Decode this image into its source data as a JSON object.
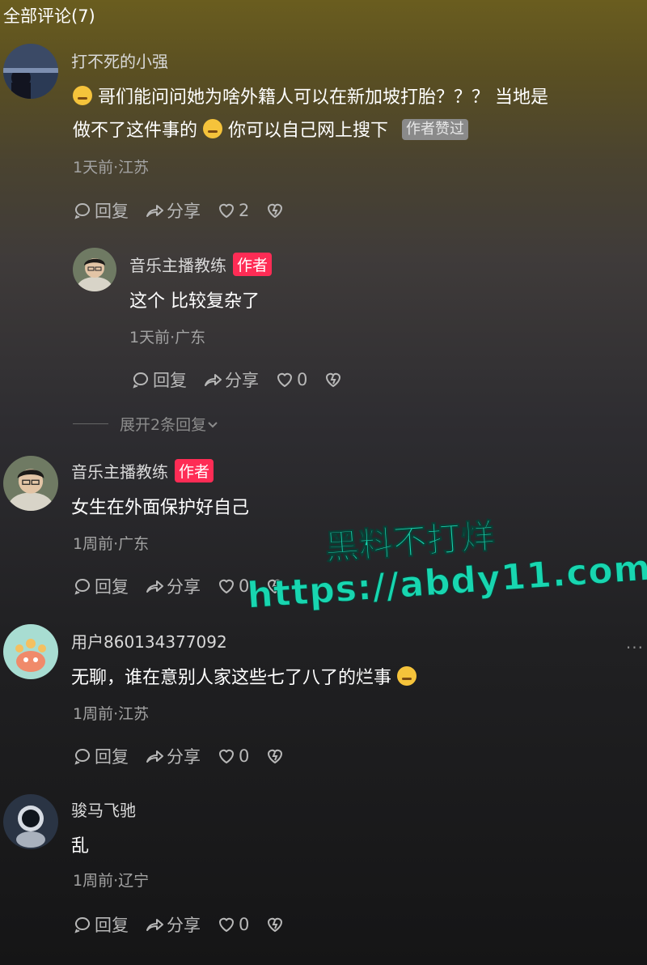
{
  "header": {
    "title": "全部评论(7)"
  },
  "comments": [
    {
      "name": "打不死的小强",
      "text_a": "哥们能问问她为啥外籍人可以在新加坡打胎？？？ 当地是",
      "text_b": "做不了这件事的",
      "text_c": "你可以自己网上搜下",
      "liked_badge": "作者赞过",
      "meta": "1天前·江苏",
      "reply_label": "回复",
      "share_label": "分享",
      "likes": "2"
    },
    {
      "name": "音乐主播教练",
      "badge": "作者",
      "text": "这个 比较复杂了",
      "meta": "1天前·广东",
      "reply_label": "回复",
      "share_label": "分享",
      "likes": "0"
    },
    {
      "name": "音乐主播教练",
      "badge": "作者",
      "text": "女生在外面保护好自己",
      "meta": "1周前·广东",
      "reply_label": "回复",
      "share_label": "分享",
      "likes": "0"
    },
    {
      "name": "用户860134377092",
      "text": "无聊，谁在意别人家这些七了八了的烂事",
      "meta": "1周前·江苏",
      "reply_label": "回复",
      "share_label": "分享",
      "likes": "0"
    },
    {
      "name": "骏马飞驰",
      "text": "乱",
      "meta": "1周前·辽宁",
      "reply_label": "回复",
      "share_label": "分享",
      "likes": "0"
    }
  ],
  "expand_replies": "展开2条回复",
  "watermark": {
    "line1": "黑料不打烊",
    "line2": "https://abdy11.com"
  },
  "icons": [
    "comment-bubble-icon",
    "share-arrow-icon",
    "heart-icon",
    "dislike-heart-icon",
    "more-dots-icon",
    "chevron-down-icon"
  ]
}
